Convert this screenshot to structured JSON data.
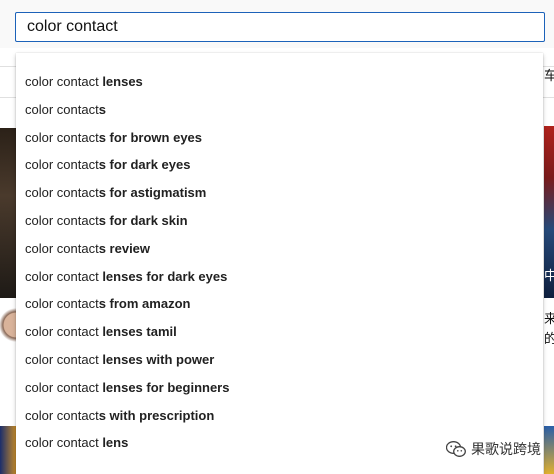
{
  "search": {
    "value": "color contact",
    "accent_color": "#1c62b9"
  },
  "suggestions": [
    {
      "typed": "color contact",
      "completion": " lenses"
    },
    {
      "typed": "color contact",
      "completion": "s"
    },
    {
      "typed": "color contact",
      "completion": "s for brown eyes"
    },
    {
      "typed": "color contact",
      "completion": "s for dark eyes"
    },
    {
      "typed": "color contact",
      "completion": "s for astigmatism"
    },
    {
      "typed": "color contact",
      "completion": "s for dark skin"
    },
    {
      "typed": "color contact",
      "completion": "s review"
    },
    {
      "typed": "color contact",
      "completion": " lenses for dark eyes"
    },
    {
      "typed": "color contact",
      "completion": "s from amazon"
    },
    {
      "typed": "color contact",
      "completion": " lenses tamil"
    },
    {
      "typed": "color contact",
      "completion": " lenses with power"
    },
    {
      "typed": "color contact",
      "completion": " lenses for beginners"
    },
    {
      "typed": "color contact",
      "completion": "s with prescription"
    },
    {
      "typed": "color contact",
      "completion": " lens"
    }
  ],
  "background": {
    "right_fragments": [
      "车",
      "中",
      "来",
      "的"
    ]
  },
  "watermark": {
    "text": "果歌说跨境",
    "icon": "wechat-icon"
  }
}
